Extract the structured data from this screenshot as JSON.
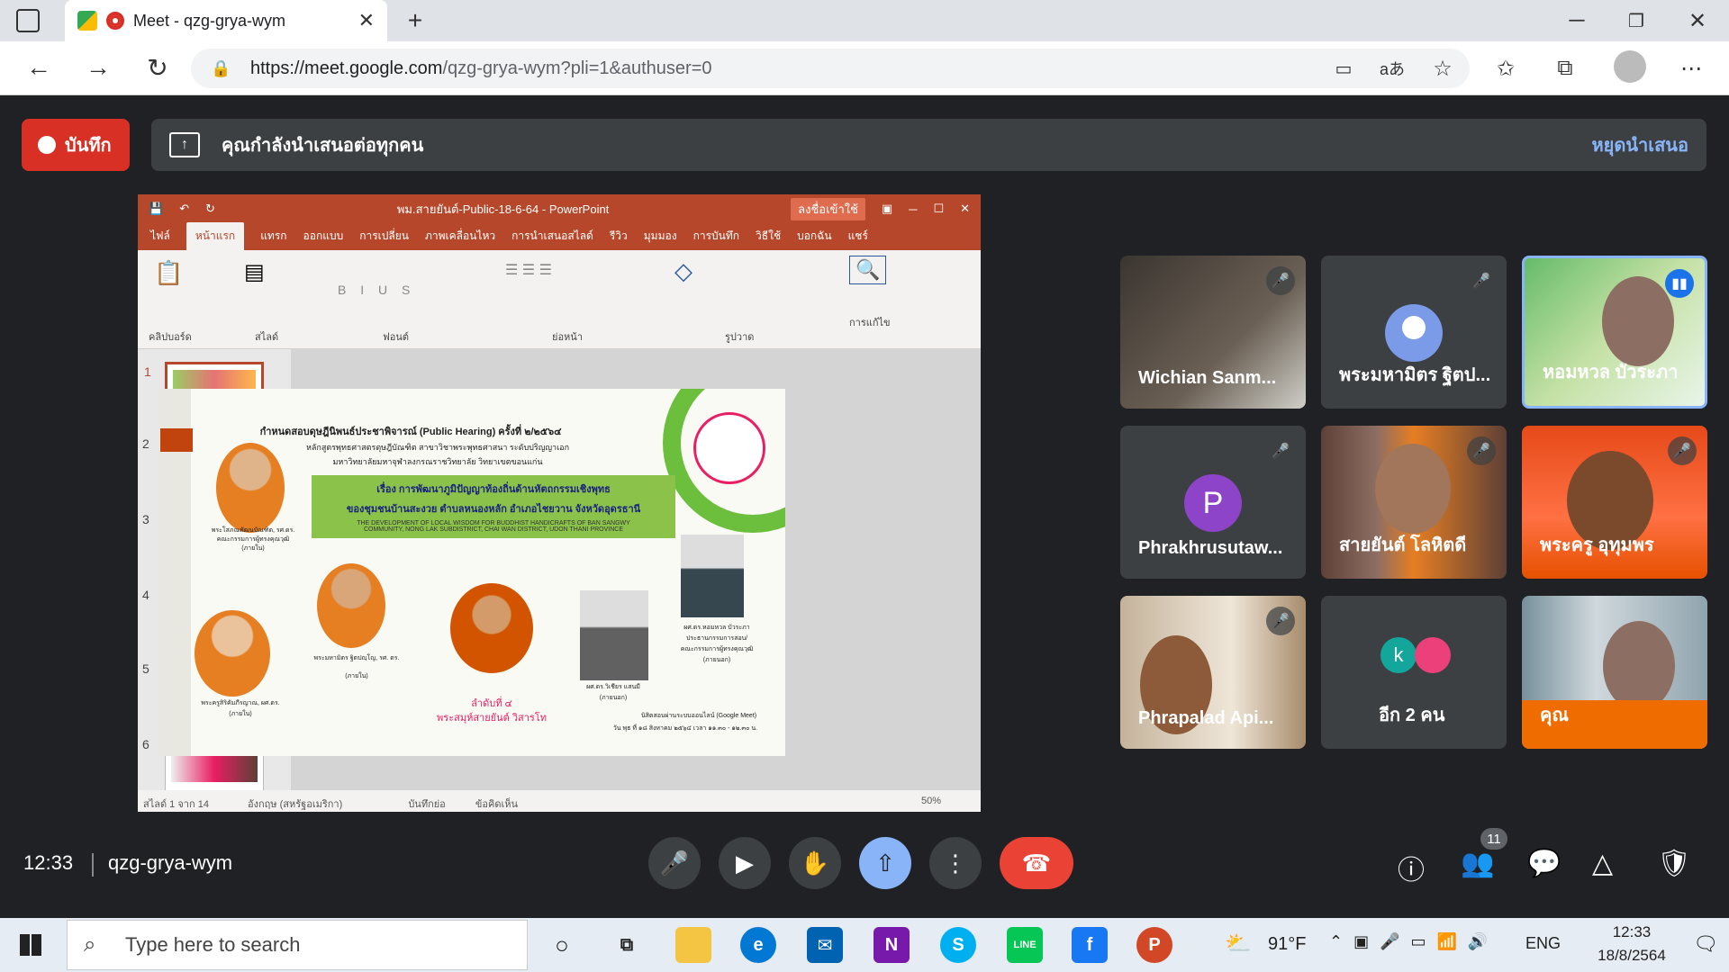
{
  "browser": {
    "tab_title": "Meet - qzg-grya-wym",
    "url_host": "https://meet.google.com",
    "url_rest": "/qzg-grya-wym?pli=1&authuser=0"
  },
  "meet": {
    "record_label": "บันทึก",
    "presenting_text": "คุณกำลังนำเสนอต่อทุกคน",
    "stop_presenting": "หยุดนำเสนอ",
    "clock": "12:33",
    "meeting_code": "qzg-grya-wym",
    "people_count": "11"
  },
  "ppt": {
    "file_title": "พม.สายยันต์-Public-18-6-64 - PowerPoint",
    "signin": "ลงชื่อเข้าใช้",
    "tabs": [
      "ไฟล์",
      "หน้าแรก",
      "แทรก",
      "ออกแบบ",
      "การเปลี่ยน",
      "ภาพเคลื่อนไหว",
      "การนำเสนอสไลด์",
      "รีวิว",
      "มุมมอง",
      "การบันทึก",
      "วิธีใช้",
      "บอกฉัน",
      "แชร์"
    ],
    "groups": [
      "คลิปบอร์ด",
      "สไลด์",
      "ฟอนต์",
      "ย่อหน้า",
      "รูปวาด",
      "การแก้ไข"
    ],
    "thumb_numbers": [
      "1",
      "2",
      "3",
      "4",
      "5",
      "6"
    ],
    "status": "สไลด์ 1 จาก 14",
    "status_lang": "อังกฤษ (สหรัฐอเมริกา)",
    "status_notes": "บันทึกย่อ",
    "status_comments": "ข้อคิดเห็น",
    "zoom": "50%"
  },
  "slide": {
    "headline": "กำหนดสอบดุษฎีนิพนธ์ประชาพิจารณ์ (Public Hearing) ครั้งที่ ๒/๒๕๖๔",
    "program": "หลักสูตรพุทธศาสตรดุษฎีบัณฑิต สาขาวิชาพระพุทธศาสนา ระดับปริญญาเอก",
    "university": "มหาวิทยาลัยมหาจุฬาลงกรณราชวิทยาลัย วิทยาเขตขอนแก่น",
    "topic1": "เรื่อง การพัฒนาภูมิปัญญาท้องถิ่นด้านหัตถกรรมเชิงพุทธ",
    "topic2": "ของชุมชนบ้านสะงวย ตำบลหนองหลัก อำเภอไชยวาน จังหวัดอุดรธานี",
    "en1": "THE DEVELOPMENT OF LOCAL WISDOM FOR BUDDHIST HANDICRAFTS OF BAN SANGWY",
    "en2": "COMMUNITY, NONG LAK SUBDISTRICT, CHAI WAN DISTRICT, UDON THANI PROVINCE",
    "p1": "พระโสภณพัฒนบัณฑิต, รศ.ดร.",
    "p1b": "คณะกรรมการผู้ทรงคุณวุฒิ",
    "p1c": "(ภายใน)",
    "p2": "พระมหามิตร ฐิตปญฺโญ, รศ. ดร.",
    "p2c": "(ภายใน)",
    "p3": "พระครูสิริคัมภีรญาณ, ผศ.ดร.",
    "p3c": "(ภายใน)",
    "order": "ลำดับที่ ๔",
    "candidate": "พระสมุห์สายยันต์ วิสารโท",
    "p4": "ผศ.ดร.วิเชียร แสนมี",
    "p4c": "(ภายนอก)",
    "p5": "ผศ.ดร.หอมหวล บัวระภา",
    "p5b": "ประธานกรรมการสอบ/",
    "p5d": "คณะกรรมการผู้ทรงคุณวุฒิ",
    "p5c": "(ภายนอก)",
    "online": "นิสิตสอบผ่านระบบออนไลน์ (Google Meet)",
    "date": "วัน พุธ ที่ ๑๘ สิงหาคม ๒๕๖๔ เวลา ๑๑.๓๐ - ๑๒.๓๐ น."
  },
  "participants": [
    {
      "name": "Wichian Sanm...",
      "muted": true
    },
    {
      "name": "พระมหามิตร ฐิตป...",
      "muted": true,
      "initial": "",
      "color": "#7b9be8"
    },
    {
      "name": "หอมหวล บัวระภา",
      "speaking": true
    },
    {
      "name": "Phrakhrusutaw...",
      "muted": true,
      "initial": "P",
      "color": "#8e44c8"
    },
    {
      "name": "สายยันต์ โลหิตดี",
      "muted": true
    },
    {
      "name": "พระครู อุทุมพร",
      "muted": true
    },
    {
      "name": "Phrapalad Api...",
      "muted": true
    },
    {
      "name": "อีก 2 คน",
      "initial": "k"
    },
    {
      "name": "คุณ"
    }
  ],
  "taskbar": {
    "search_placeholder": "Type here to search",
    "weather": "91°F",
    "lang": "ENG",
    "time": "12:33",
    "date": "18/8/2564"
  }
}
